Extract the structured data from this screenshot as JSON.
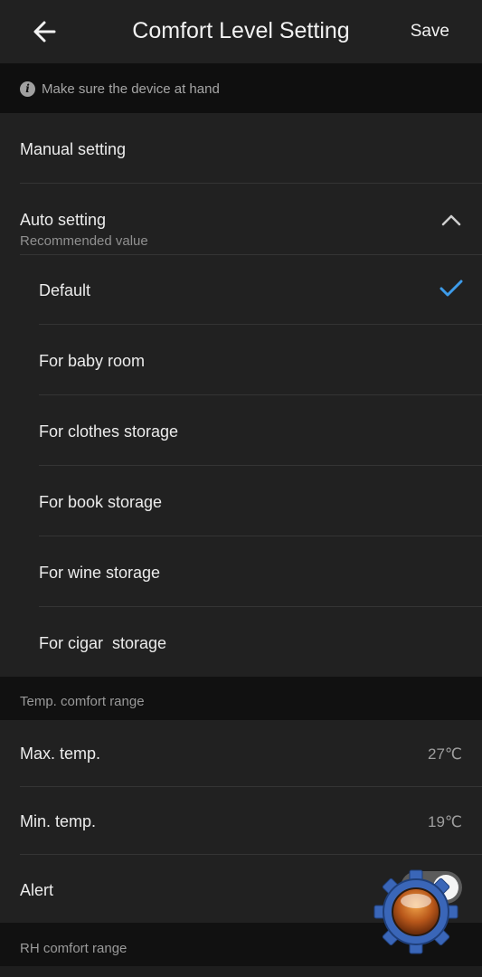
{
  "header": {
    "title": "Comfort Level Setting",
    "save_label": "Save"
  },
  "info": {
    "icon": "info-icon",
    "text": "Make sure the device at hand"
  },
  "settings": {
    "manual_label": "Manual setting",
    "auto_label": "Auto setting",
    "auto_sublabel": "Recommended value",
    "options": [
      {
        "label": "Default",
        "selected": true
      },
      {
        "label": "For baby room",
        "selected": false
      },
      {
        "label": "For clothes storage",
        "selected": false
      },
      {
        "label": "For book storage",
        "selected": false
      },
      {
        "label": "For wine storage",
        "selected": false
      },
      {
        "label": "For cigar  storage",
        "selected": false
      }
    ]
  },
  "temp": {
    "section_title": "Temp. comfort range",
    "max_label": "Max. temp.",
    "max_value": "27℃",
    "min_label": "Min. temp.",
    "min_value": "19℃",
    "alert_label": "Alert",
    "alert_on": true
  },
  "rh": {
    "section_title": "RH comfort range"
  },
  "colors": {
    "accent": "#3d9be9",
    "background": "#111111",
    "card": "#212121"
  }
}
